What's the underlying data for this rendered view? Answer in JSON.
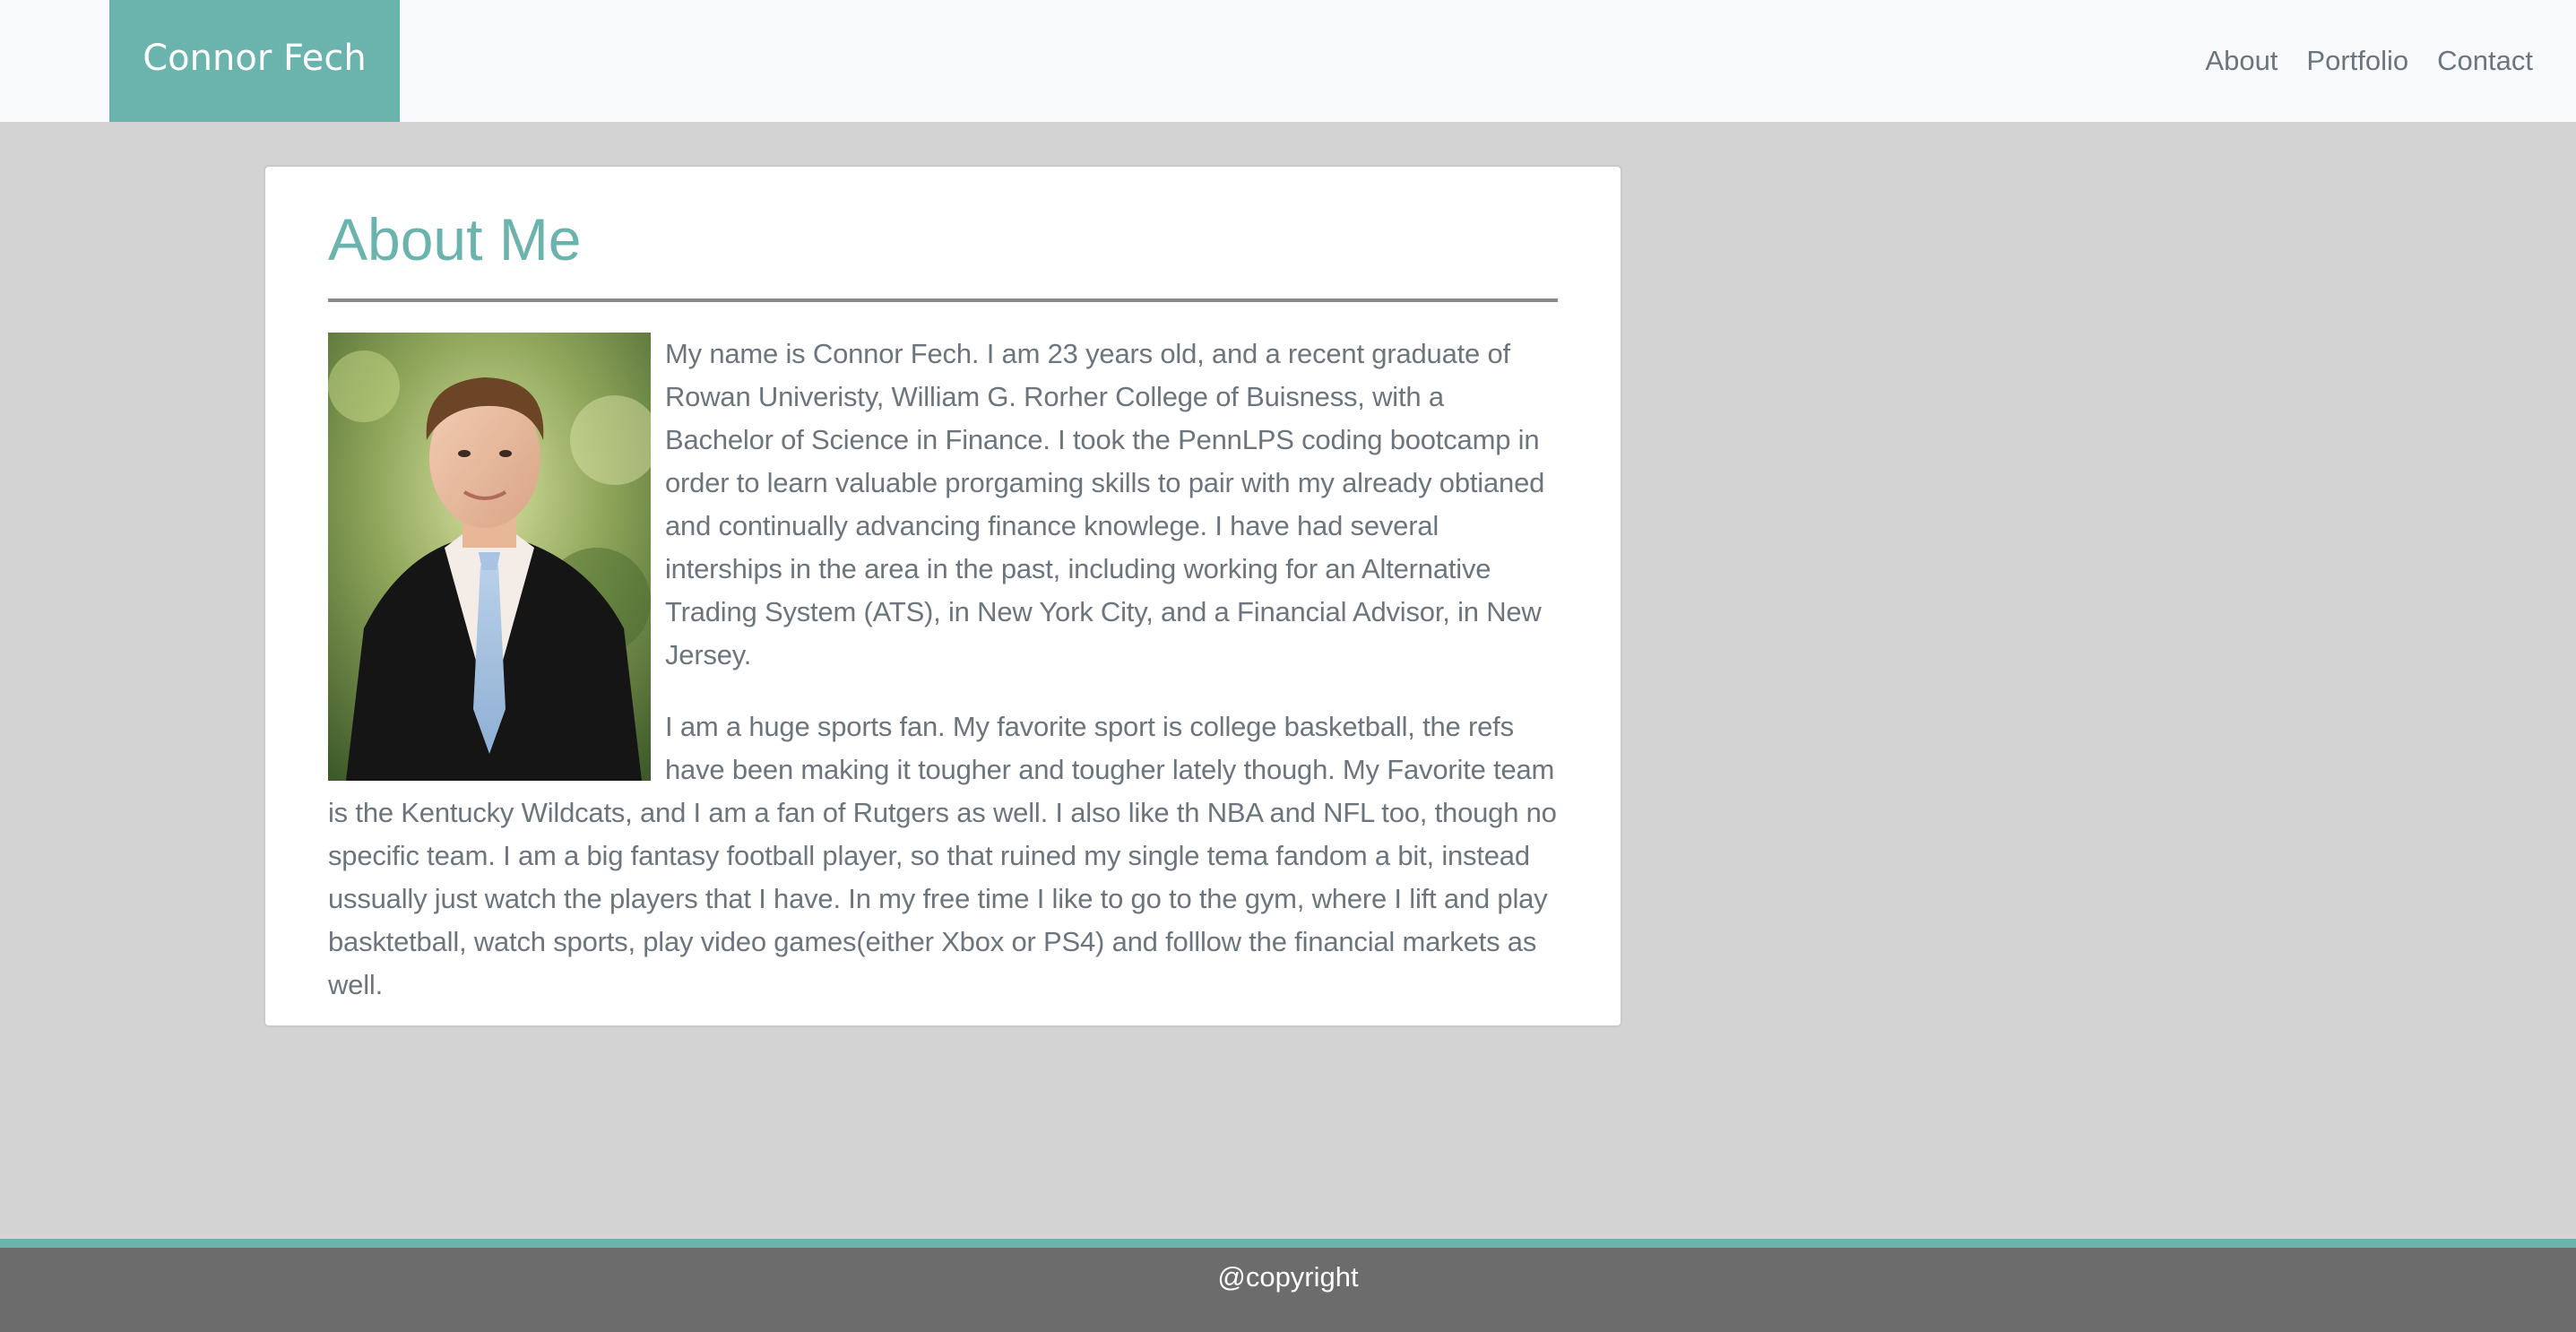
{
  "navbar": {
    "brand": "Connor Fech",
    "links": [
      "About",
      "Portfolio",
      "Contact"
    ]
  },
  "about": {
    "title": "About Me",
    "image_alt": "Portrait of Connor Fech",
    "paragraphs": [
      "My name is Connor Fech. I am 23 years old, and a recent graduate of Rowan Univeristy, William G. Rorher College of Buisness, with a Bachelor of Science in Finance. I took the PennLPS coding bootcamp in order to learn valuable prorgaming skills to pair with my already obtianed and continually advancing finance knowlege. I have had several interships in the area in the past, including working for an Alternative Trading System (ATS), in New York City, and a Financial Advisor, in New Jersey.",
      "I am a huge sports fan. My favorite sport is college basketball, the refs have been making it tougher and tougher lately though. My Favorite team is the Kentucky Wildcats, and I am a fan of Rutgers as well. I also like th NBA and NFL too, though no specific team. I am a big fantasy football player, so that ruined my single tema fandom a bit, instead ussually just watch the players that I have. In my free time I like to go to the gym, where I lift and play basktetball, watch sports, play video games(either Xbox or PS4) and folllow the financial markets as well."
    ]
  },
  "footer": {
    "text": "@copyright"
  },
  "colors": {
    "accent": "#6ab4ad",
    "page_background": "#d3d3d3",
    "footer_background": "#6c6c6c",
    "body_text": "#6c757d"
  }
}
